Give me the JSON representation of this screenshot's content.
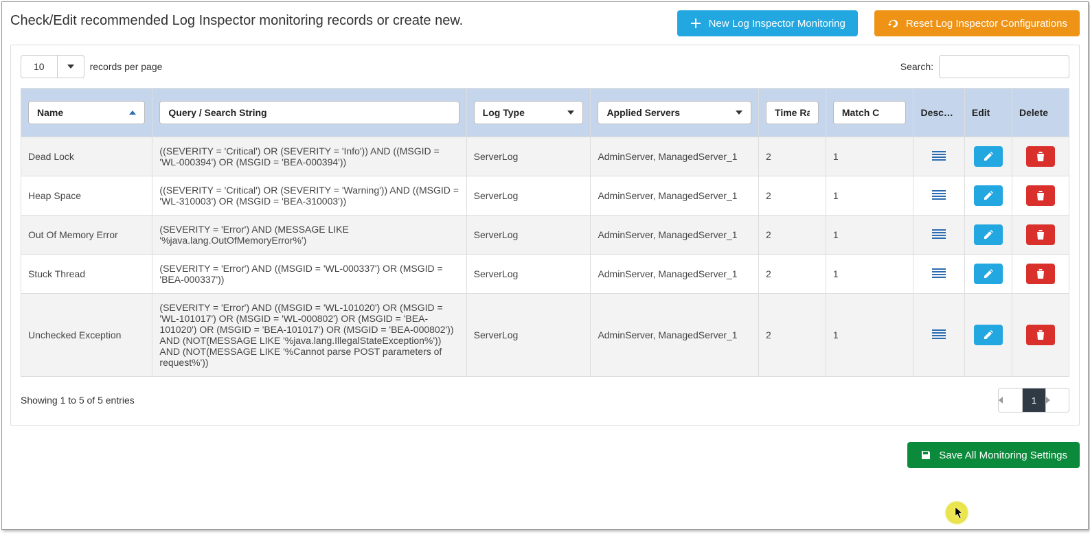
{
  "header": {
    "title": "Check/Edit recommended Log Inspector monitoring records or create new.",
    "new_btn": "New Log Inspector Monitoring",
    "reset_btn": "Reset Log Inspector Configurations"
  },
  "controls": {
    "page_size": "10",
    "records_per_page_label": "records per page",
    "search_label": "Search:"
  },
  "columns": {
    "name": "Name",
    "query": "Query / Search String",
    "log_type": "Log Type",
    "servers": "Applied Servers",
    "time_range": "Time Ra",
    "match_count": "Match C",
    "desc": "Desc…",
    "edit": "Edit",
    "delete": "Delete"
  },
  "rows": [
    {
      "name": "Dead Lock",
      "query": "((SEVERITY = 'Critical') OR (SEVERITY = 'Info')) AND ((MSGID = 'WL-000394') OR (MSGID = 'BEA-000394'))",
      "log_type": "ServerLog",
      "servers": "AdminServer, ManagedServer_1",
      "time_range": "2",
      "match_count": "1"
    },
    {
      "name": "Heap Space",
      "query": "((SEVERITY = 'Critical') OR (SEVERITY = 'Warning')) AND ((MSGID = 'WL-310003') OR (MSGID = 'BEA-310003'))",
      "log_type": "ServerLog",
      "servers": "AdminServer, ManagedServer_1",
      "time_range": "2",
      "match_count": "1"
    },
    {
      "name": "Out Of Memory Error",
      "query": "(SEVERITY = 'Error') AND (MESSAGE LIKE '%java.lang.OutOfMemoryError%')",
      "log_type": "ServerLog",
      "servers": "AdminServer, ManagedServer_1",
      "time_range": "2",
      "match_count": "1"
    },
    {
      "name": "Stuck Thread",
      "query": "(SEVERITY = 'Error') AND ((MSGID = 'WL-000337') OR (MSGID = 'BEA-000337'))",
      "log_type": "ServerLog",
      "servers": "AdminServer, ManagedServer_1",
      "time_range": "2",
      "match_count": "1"
    },
    {
      "name": "Unchecked Exception",
      "query": "(SEVERITY = 'Error') AND ((MSGID = 'WL-101020') OR (MSGID = 'WL-101017') OR (MSGID = 'WL-000802') OR (MSGID = 'BEA-101020') OR (MSGID = 'BEA-101017') OR (MSGID = 'BEA-000802')) AND (NOT(MESSAGE LIKE '%java.lang.IllegalStateException%')) AND (NOT(MESSAGE LIKE '%Cannot parse POST parameters of request%'))",
      "log_type": "ServerLog",
      "servers": "AdminServer, ManagedServer_1",
      "time_range": "2",
      "match_count": "1"
    }
  ],
  "footer": {
    "info": "Showing 1 to 5 of 5 entries",
    "page_current": "1"
  },
  "save_btn": "Save All Monitoring Settings"
}
